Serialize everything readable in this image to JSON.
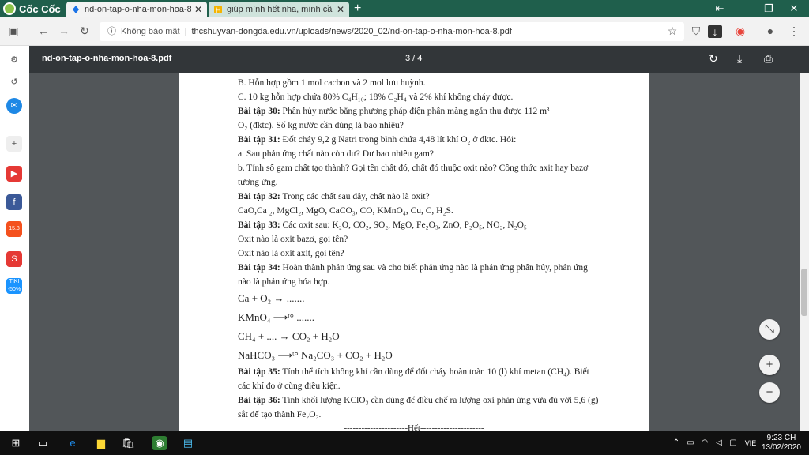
{
  "browser": {
    "brand": "Cốc Cốc",
    "tabs": [
      {
        "title": "nd-on-tap-o-nha-mon-hoa-8.",
        "close": "✕"
      },
      {
        "title": "giúp mình hết nha, mình cần",
        "close": "✕"
      }
    ],
    "new_tab": "+",
    "window": {
      "menu": "⇤",
      "minimize": "—",
      "restore": "❐",
      "close": "✕"
    },
    "address": {
      "security": "Không bảo mật",
      "url": "thcshuyvan-dongda.edu.vn/uploads/news/2020_02/nd-on-tap-o-nha-mon-hoa-8.pdf"
    }
  },
  "pdf": {
    "filename": "nd-on-tap-o-nha-mon-hoa-8.pdf",
    "page_indicator": "3 / 4",
    "lines": [
      {
        "b": "",
        "t": "B. Hỗn hợp gồm 1 mol cacbon và 2 mol lưu huỳnh."
      },
      {
        "b": "",
        "t": "C. 10 kg hỗn hợp chứa 80% C₄H₁₀; 18% C₂H₄ và 2% khí không cháy được."
      },
      {
        "b": "Bài tập 30:",
        "t": " Phân hủy nước bằng phương pháp điện phân màng ngăn thu được 112 m³"
      },
      {
        "b": "",
        "t": "O₂ (đktc). Số kg nước cần dùng là bao nhiêu?"
      },
      {
        "b": "Bài tập 31:",
        "t": " Đốt cháy 9,2 g Natri trong bình chứa 4,48 lít khí O₂ ở đktc. Hỏi:"
      },
      {
        "b": "",
        "t": "a. Sau phản ứng chất nào còn dư? Dư bao nhiêu gam?"
      },
      {
        "b": "",
        "t": "b. Tính số gam chất tạo thành? Gọi tên chất đó, chất đó thuộc oxit nào? Công thức axit hay bazơ"
      },
      {
        "b": "",
        "t": "tương ứng."
      },
      {
        "b": "Bài tập 32:",
        "t": " Trong các chất sau đây, chất nào là oxit?"
      },
      {
        "b": "",
        "t": "CaO,Ca ₂, MgCl₂, MgO, CaCO₃, CO, KMnO₄, Cu, C, H₂S."
      },
      {
        "b": "Bài tập 33:",
        "t": " Các oxit sau: K₂O, CO₂, SO₂, MgO, Fe₂O₃, ZnO, P₂O₅, NO₂, N₂O₅"
      },
      {
        "b": "",
        "t": "Oxit nào là oxit bazơ, gọi tên?"
      },
      {
        "b": "",
        "t": "Oxit nào là oxit axit, gọi tên?"
      },
      {
        "b": "Bài tập 34:",
        "t": " Hoàn thành phản ứng sau và cho biết phản ứng nào là phản ứng phân hủy, phản ứng"
      },
      {
        "b": "",
        "t": "nào là phản ứng hóa hợp."
      }
    ],
    "equations": [
      "Ca + O₂ → .......",
      "KMnO₄ ⟶ᵗ° .......",
      "CH₄ + .... → CO₂ + H₂O",
      "NaHCO₃ ⟶ᵗ° Na₂CO₃ + CO₂ + H₂O"
    ],
    "lines2": [
      {
        "b": "Bài tập 35:",
        "t": " Tính thể tích không khí cần dùng để đốt cháy hoàn toàn 10 (l) khí metan (CH₄). Biết"
      },
      {
        "b": "",
        "t": "các khí đo ở cùng điều kiện."
      },
      {
        "b": "Bài tập 36:",
        "t": " Tính khối lượng KClO₃ cần dùng để điều chế ra lượng oxi phản ứng vừa đủ với 5,6 (g)"
      },
      {
        "b": "",
        "t": "sắt để tạo thành Fe₂O₃."
      }
    ],
    "end_text": "----------------------Hết----------------------",
    "scroll_position": 0.55
  },
  "sidebar_badges": {
    "shopee": "15.8",
    "tiki": "TIKI -50%"
  },
  "taskbar": {
    "lang": "VIE",
    "time": "9:23 CH",
    "date": "13/02/2020"
  }
}
